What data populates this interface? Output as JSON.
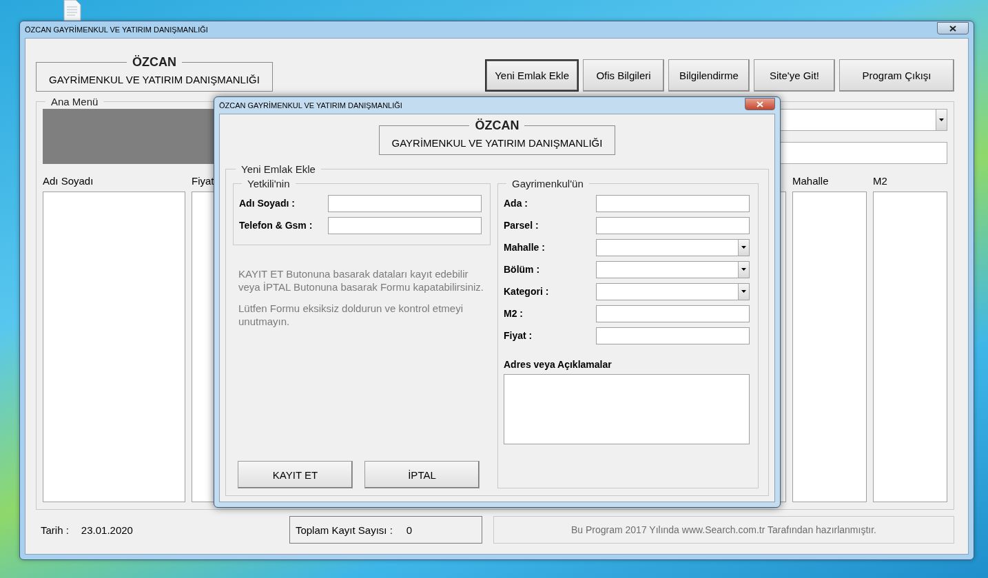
{
  "main_window": {
    "title": "ÖZCAN GAYRİMENKUL VE YATIRIM DANIŞMANLIĞI",
    "header": {
      "title": "ÖZCAN",
      "subtitle": "GAYRİMENKUL VE YATIRIM DANIŞMANLIĞI"
    },
    "toolbar": [
      {
        "label": "Yeni Emlak Ekle",
        "focused": true
      },
      {
        "label": "Ofis Bilgileri",
        "focused": false
      },
      {
        "label": "Bilgilendirme",
        "focused": false
      },
      {
        "label": "Site'ye Git!",
        "focused": false
      },
      {
        "label": "Program Çıkışı",
        "focused": false
      }
    ],
    "main_menu": {
      "title": "Ana Menü",
      "columns": [
        "Adı Soyadı",
        "Fiyat",
        "Mahalle",
        "M2"
      ]
    },
    "footer": {
      "date_label": "Tarih :",
      "date": "23.01.2020",
      "count_label": "Toplam Kayıt Sayısı :",
      "count": "0",
      "credit": "Bu Program 2017 Yılında www.Search.com.tr Tarafından hazırlanmıştır."
    }
  },
  "dialog": {
    "title": "ÖZCAN GAYRİMENKUL VE YATIRIM DANIŞMANLIĞI",
    "header": {
      "title": "ÖZCAN",
      "subtitle": "GAYRİMENKUL VE YATIRIM DANIŞMANLIĞI"
    },
    "group_title": "Yeni Emlak Ekle",
    "contact": {
      "title": "Yetkili'nin",
      "fields": [
        {
          "label": "Adı Soyadı :",
          "kind": "text"
        },
        {
          "label": "Telefon & Gsm :",
          "kind": "text"
        }
      ]
    },
    "notes": [
      "KAYIT ET Butonuna basarak dataları kayıt edebilir veya İPTAL Butonuna basarak Formu kapatabilirsiniz.",
      "Lütfen Formu eksiksiz doldurun ve kontrol etmeyi unutmayın."
    ],
    "buttons": [
      "KAYIT ET",
      "İPTAL"
    ],
    "property": {
      "title": "Gayrimenkul'ün",
      "fields": [
        {
          "label": "Ada :",
          "kind": "text"
        },
        {
          "label": "Parsel :",
          "kind": "text"
        },
        {
          "label": "Mahalle :",
          "kind": "dropdown"
        },
        {
          "label": "Bölüm :",
          "kind": "dropdown"
        },
        {
          "label": "Kategori :",
          "kind": "dropdown"
        },
        {
          "label": "M2 :",
          "kind": "text"
        },
        {
          "label": "Fiyat :",
          "kind": "text"
        }
      ],
      "notes_label": "Adres veya Açıklamalar"
    }
  }
}
